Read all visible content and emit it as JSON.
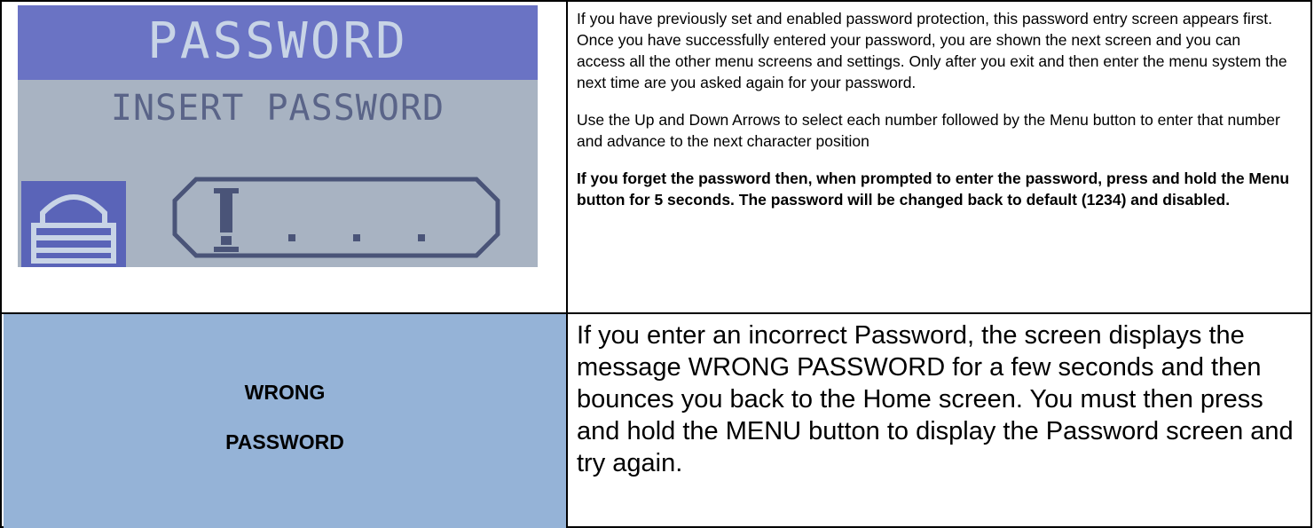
{
  "lcd": {
    "title": "PASSWORD",
    "subtitle": "INSERT PASSWORD",
    "lock_icon": "padlock-icon",
    "cursor_icon": "cursor-bar-icon"
  },
  "row1": {
    "paragraph1": "If you have previously set and enabled password protection, this password entry screen appears first. Once you have successfully entered your password, you are shown the next screen and you can access all the other menu screens and settings. Only after you exit and then enter the menu system the next time are you asked again for your password.",
    "paragraph2": "Use the Up and Down Arrows to select each number followed by the Menu button to enter that number and advance to the next character position",
    "paragraph3": "If you forget the password then, when prompted to enter the password, press and hold the Menu button for 5 seconds. The password will be changed back to default (1234) and disabled."
  },
  "row2": {
    "label_line1": "WRONG",
    "label_line2": "PASSWORD",
    "description": "If you enter an incorrect Password, the screen displays the message WRONG PASSWORD for a few seconds and then bounces you back to the Home screen. You must then press and hold the MENU button to display the Password screen and try again."
  },
  "colors": {
    "lcd_background": "#a8b3c2",
    "lcd_banner": "#6a73c4",
    "label_cell": "#95b3d7"
  }
}
